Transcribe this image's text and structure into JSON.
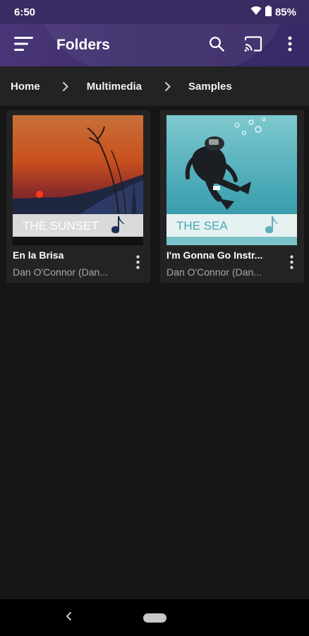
{
  "status_bar": {
    "time": "6:50",
    "battery": "85%"
  },
  "app_bar": {
    "title": "Folders"
  },
  "breadcrumb": [
    "Home",
    "Multimedia",
    "Samples"
  ],
  "items": [
    {
      "title": "En la Brisa",
      "subtitle": "Dan O'Connor (Dan...",
      "art_caption": "THE SUNSET"
    },
    {
      "title": "I'm Gonna Go Instr...",
      "subtitle": "Dan O'Connor (Dan...",
      "art_caption": "THE SEA"
    }
  ],
  "colors": {
    "app_bar": "#3e2d6c",
    "background": "#161616",
    "card": "#232323"
  }
}
